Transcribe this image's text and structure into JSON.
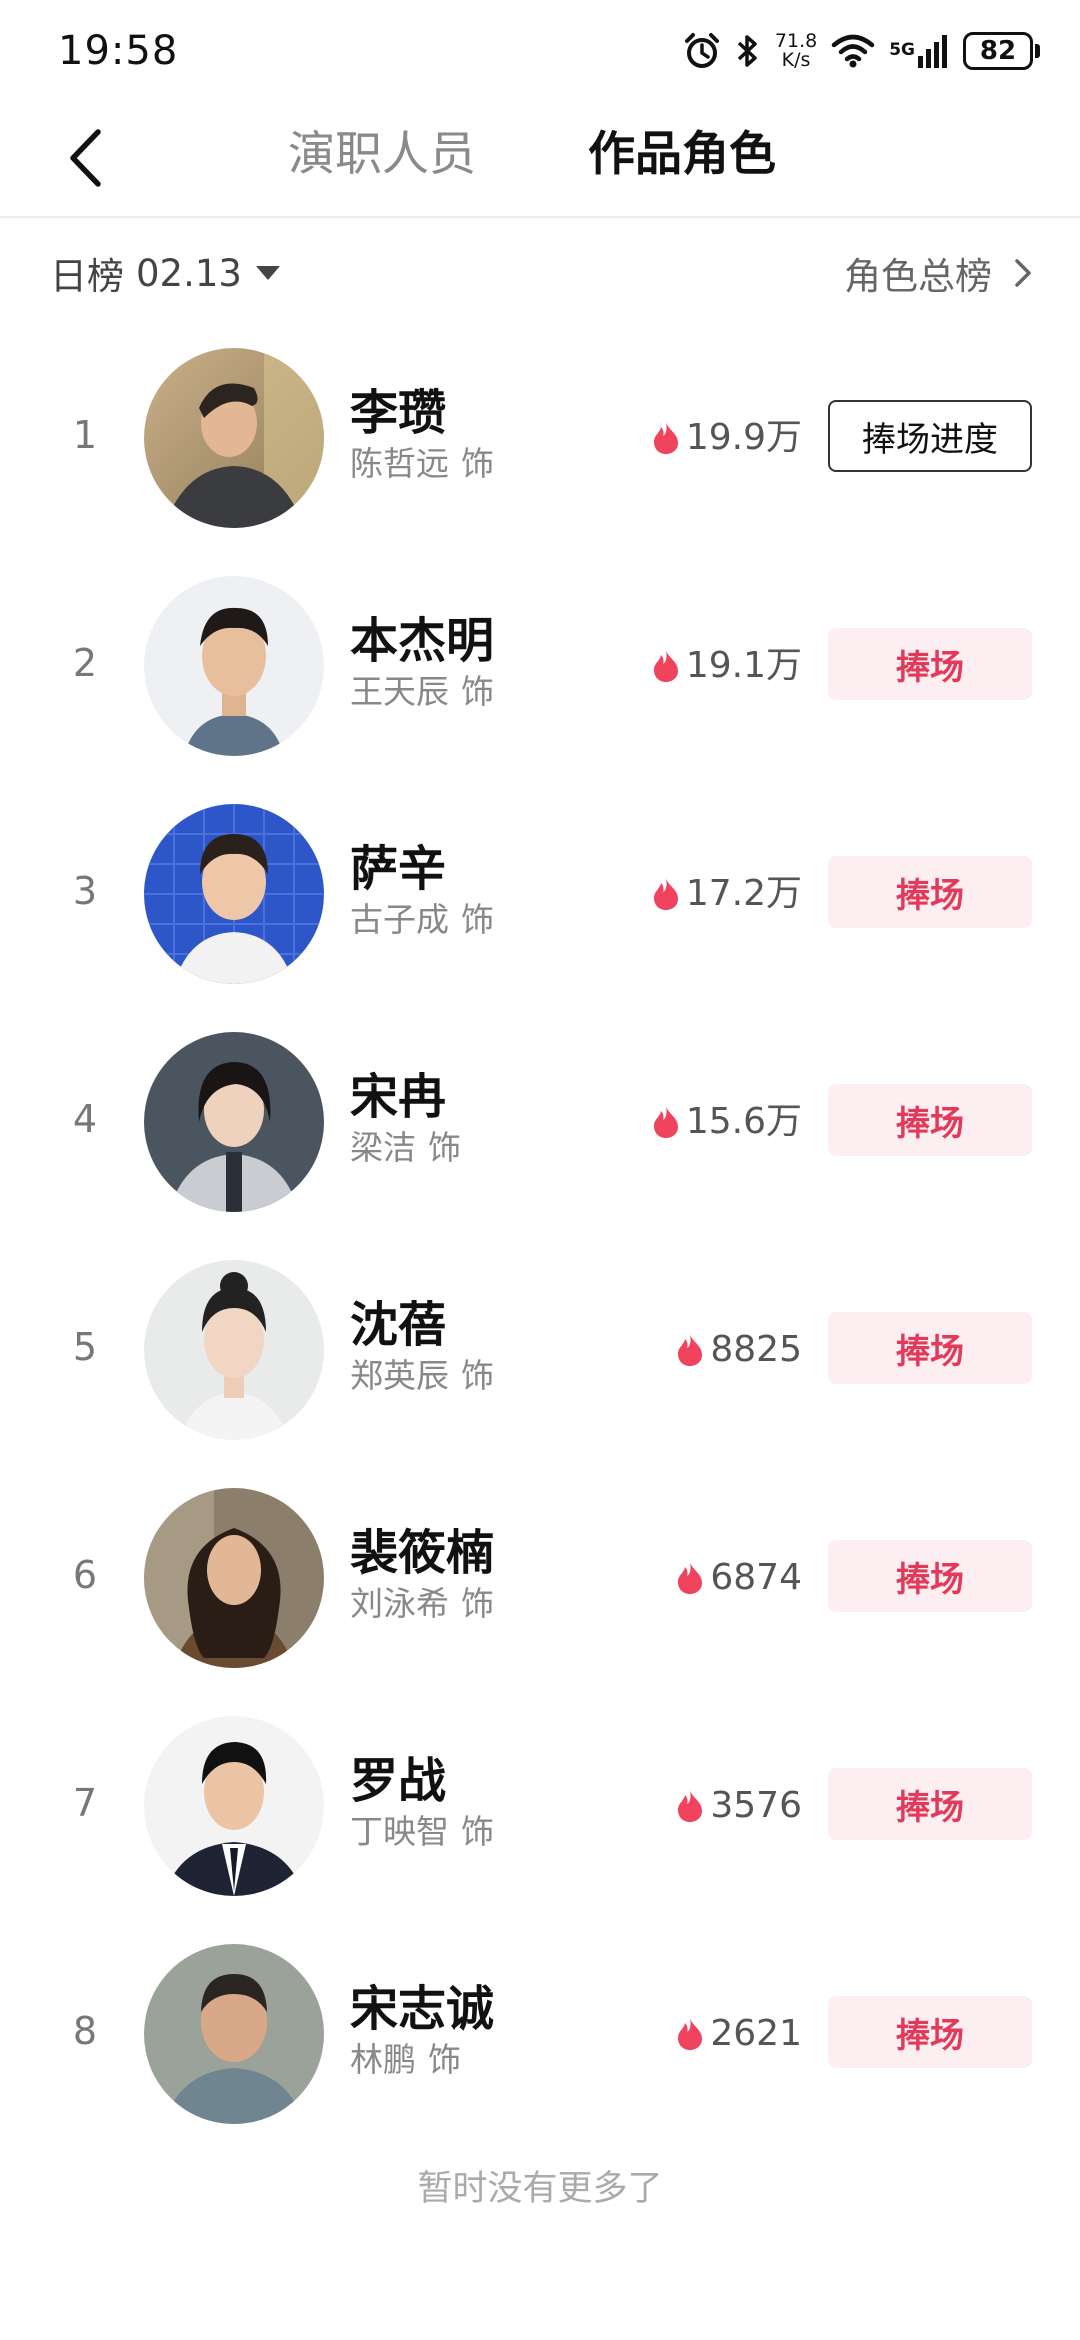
{
  "status": {
    "time": "19:58",
    "net_speed_value": "71.8",
    "net_speed_unit": "K/s",
    "signal_label": "5G",
    "battery": "82"
  },
  "nav": {
    "back_icon": "chevron-left-icon",
    "tabs": [
      {
        "label": "演职人员",
        "active": false
      },
      {
        "label": "作品角色",
        "active": true
      }
    ]
  },
  "filter": {
    "date_label": "日榜",
    "date_value": "02.13",
    "total_link": "角色总榜"
  },
  "accent_color": "#e23a5a",
  "items": [
    {
      "rank": "1",
      "role": "李瓒",
      "actor": "陈哲远",
      "suffix": "饰",
      "heat": "19.9万",
      "button": "捧场进度",
      "button_style": "outline"
    },
    {
      "rank": "2",
      "role": "本杰明",
      "actor": "王天辰",
      "suffix": "饰",
      "heat": "19.1万",
      "button": "捧场",
      "button_style": "fill"
    },
    {
      "rank": "3",
      "role": "萨辛",
      "actor": "古子成",
      "suffix": "饰",
      "heat": "17.2万",
      "button": "捧场",
      "button_style": "fill"
    },
    {
      "rank": "4",
      "role": "宋冉",
      "actor": "梁洁",
      "suffix": "饰",
      "heat": "15.6万",
      "button": "捧场",
      "button_style": "fill"
    },
    {
      "rank": "5",
      "role": "沈蓓",
      "actor": "郑英辰",
      "suffix": "饰",
      "heat": "8825",
      "button": "捧场",
      "button_style": "fill"
    },
    {
      "rank": "6",
      "role": "裴筱楠",
      "actor": "刘泳希",
      "suffix": "饰",
      "heat": "6874",
      "button": "捧场",
      "button_style": "fill"
    },
    {
      "rank": "7",
      "role": "罗战",
      "actor": "丁映智",
      "suffix": "饰",
      "heat": "3576",
      "button": "捧场",
      "button_style": "fill"
    },
    {
      "rank": "8",
      "role": "宋志诚",
      "actor": "林鹏",
      "suffix": "饰",
      "heat": "2621",
      "button": "捧场",
      "button_style": "fill"
    }
  ],
  "footer": "暂时没有更多了"
}
